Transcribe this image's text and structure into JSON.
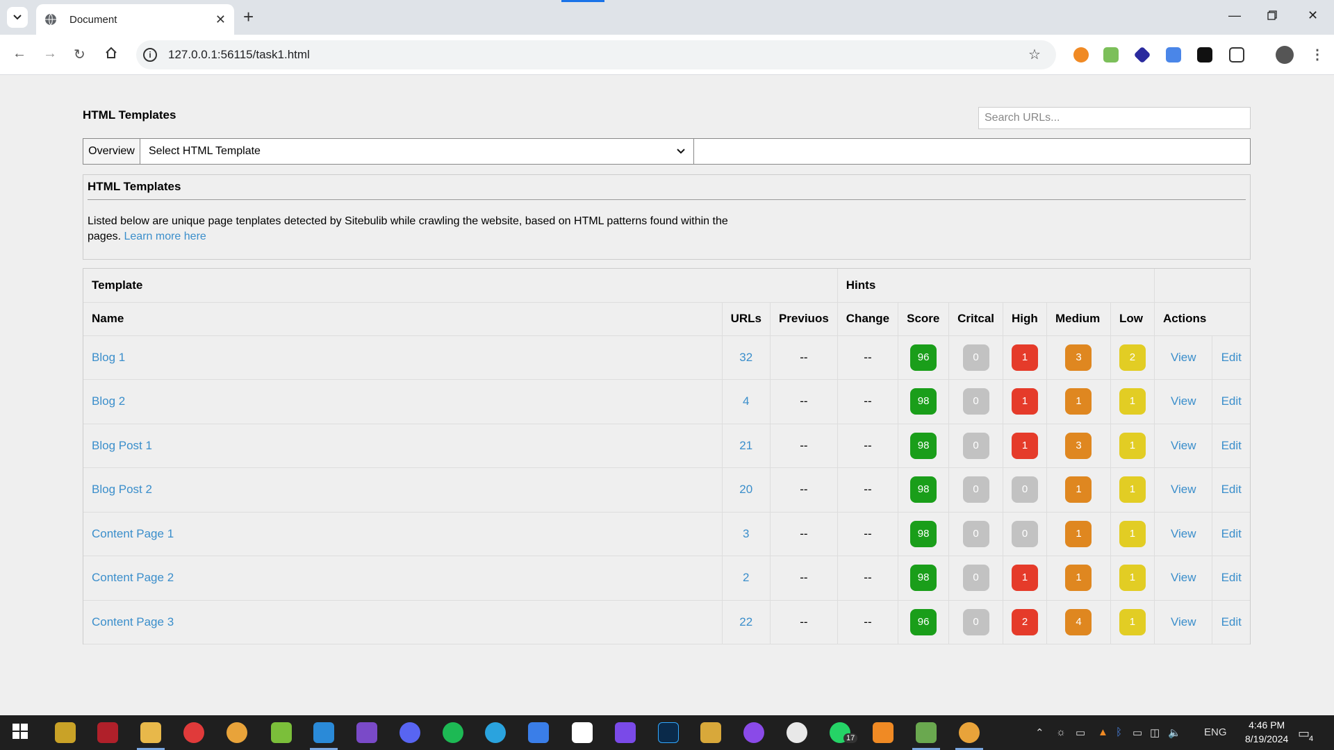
{
  "browser": {
    "tab_title": "Document",
    "url": "127.0.0.1:56115/task1.html",
    "new_tab_symbol": "+",
    "close_symbol": "✕"
  },
  "page": {
    "heading": "HTML Templates",
    "search_placeholder": "Search URLs...",
    "overview_label": "Overview",
    "select_value": "Select HTML Template"
  },
  "info": {
    "title": "HTML Templates",
    "text": "Listed below are unique page tenplates detected by Sitebulib while crawling the website, based on HTML patterns found within the pages.",
    "link": "Learn more here"
  },
  "table": {
    "group_template": "Template",
    "group_hints": "Hints",
    "columns": [
      "Name",
      "URLs",
      "Previuos",
      "Change",
      "Score",
      "Critcal",
      "High",
      "Medium",
      "Low",
      "Actions"
    ],
    "view_label": "View",
    "edit_label": "Edit",
    "rows": [
      {
        "name": "Blog 1",
        "urls": "32",
        "previous": "--",
        "change": "--",
        "score": "96",
        "critical": "0",
        "high": "1",
        "medium": "3",
        "low": "2"
      },
      {
        "name": "Blog 2",
        "urls": "4",
        "previous": "--",
        "change": "--",
        "score": "98",
        "critical": "0",
        "high": "1",
        "medium": "1",
        "low": "1"
      },
      {
        "name": "Blog Post 1",
        "urls": "21",
        "previous": "--",
        "change": "--",
        "score": "98",
        "critical": "0",
        "high": "1",
        "medium": "3",
        "low": "1"
      },
      {
        "name": "Blog Post 2",
        "urls": "20",
        "previous": "--",
        "change": "--",
        "score": "98",
        "critical": "0",
        "high": "0",
        "medium": "1",
        "low": "1"
      },
      {
        "name": "Content Page 1",
        "urls": "3",
        "previous": "--",
        "change": "--",
        "score": "98",
        "critical": "0",
        "high": "0",
        "medium": "1",
        "low": "1"
      },
      {
        "name": "Content Page 2",
        "urls": "2",
        "previous": "--",
        "change": "--",
        "score": "98",
        "critical": "0",
        "high": "1",
        "medium": "1",
        "low": "1"
      },
      {
        "name": "Content Page 3",
        "urls": "22",
        "previous": "--",
        "change": "--",
        "score": "96",
        "critical": "0",
        "high": "2",
        "medium": "4",
        "low": "1"
      }
    ]
  },
  "taskbar": {
    "time": "4:46 PM",
    "date": "8/19/2024",
    "language": "ENG",
    "whatsapp_count": "17",
    "notification_count": "4"
  },
  "colors": {
    "link": "#3a8ecb",
    "score": "#1a9e1a",
    "critical": "#c2c2c2",
    "high": "#e53b2a",
    "medium": "#df8720",
    "low": "#e2cd24"
  }
}
